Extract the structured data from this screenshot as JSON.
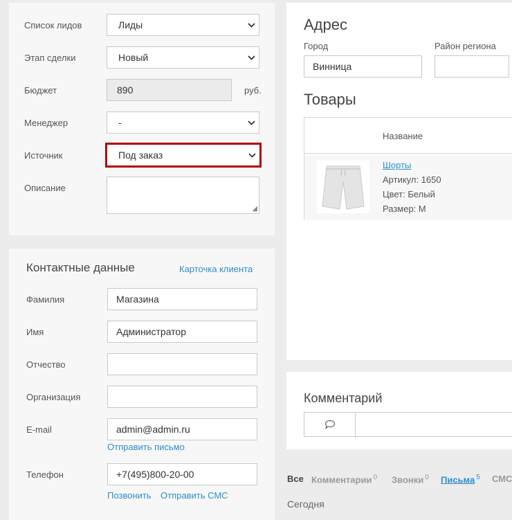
{
  "deal": {
    "leads_list_label": "Список лидов",
    "leads_list_value": "Лиды",
    "stage_label": "Этап сделки",
    "stage_value": "Новый",
    "budget_label": "Бюджет",
    "budget_value": "890",
    "budget_currency": "руб.",
    "manager_label": "Менеджер",
    "manager_value": "-",
    "source_label": "Источник",
    "source_value": "Под заказ",
    "description_label": "Описание"
  },
  "contacts": {
    "title": "Контактные данные",
    "client_card_link": "Карточка клиента",
    "lastname_label": "Фамилия",
    "lastname_value": "Магазина",
    "firstname_label": "Имя",
    "firstname_value": "Администратор",
    "patronymic_label": "Отчество",
    "patronymic_value": "",
    "org_label": "Организация",
    "org_value": "",
    "email_label": "E-mail",
    "email_value": "admin@admin.ru",
    "send_mail_link": "Отправить письмо",
    "phone_label": "Телефон",
    "phone_value": "+7(495)800-20-00",
    "call_link": "Позвонить",
    "send_sms_link": "Отправить СМС"
  },
  "address": {
    "title": "Адрес",
    "city_label": "Город",
    "city_value": "Винница",
    "region_label": "Район региона",
    "region_value": ""
  },
  "products": {
    "title": "Товары",
    "col_name": "Название",
    "items": [
      {
        "name": "Шорты",
        "article": "Артикул: 1650",
        "color": "Цвет: Белый",
        "size": "Размер: M"
      }
    ]
  },
  "comment": {
    "title": "Комментарий",
    "icon": "speech-bubble-icon"
  },
  "history_tabs": {
    "all": "Все",
    "comments": "Комментарии",
    "comments_count": "0",
    "calls": "Звонки",
    "calls_count": "0",
    "letters": "Письма",
    "letters_count": "5",
    "sms": "СМС",
    "today": "Сегодня"
  },
  "colors": {
    "accent": "#2d8fc8",
    "highlight_border": "#b00000"
  }
}
